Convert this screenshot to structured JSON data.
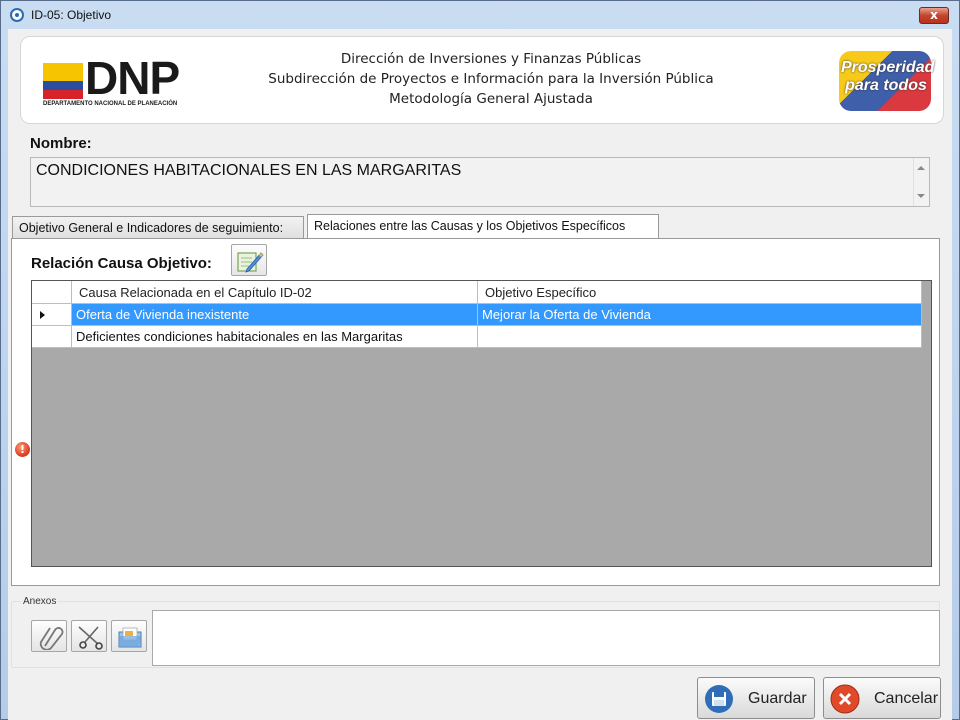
{
  "window": {
    "title": "ID-05: Objetivo",
    "close_label": "x"
  },
  "banner": {
    "logo_text": "DNP",
    "logo_subtitle": "DEPARTAMENTO NACIONAL DE PLANEACIÓN",
    "lines": [
      "Dirección de Inversiones y Finanzas Públicas",
      "Subdirección de Proyectos e Información para la Inversión Pública",
      "Metodología General Ajustada"
    ],
    "slogan_line1": "Prosperidad",
    "slogan_line2": "para todos"
  },
  "nombre": {
    "label": "Nombre:",
    "value": "CONDICIONES HABITACIONALES EN LAS MARGARITAS"
  },
  "tabs": [
    {
      "label": "Objetivo General e Indicadores de seguimiento:"
    },
    {
      "label": "Relaciones entre las Causas y los Objetivos Específicos"
    }
  ],
  "relacion": {
    "label": "Relación Causa Objetivo:"
  },
  "grid": {
    "columns": [
      "Causa Relacionada en el Capítulo ID-02",
      "Objetivo Específico"
    ],
    "rows": [
      {
        "causa": "Oferta de Vivienda inexistente",
        "objetivo": "Mejorar la Oferta de Vivienda",
        "selected": true
      },
      {
        "causa": "Deficientes condiciones habitacionales en las Margaritas",
        "objetivo": "",
        "selected": false
      }
    ]
  },
  "error_icon": "!",
  "anexos": {
    "label": "Anexos",
    "tools": [
      "paperclip-icon",
      "scissors-icon",
      "folder-icon"
    ]
  },
  "buttons": {
    "guardar": "Guardar",
    "cancelar": "Cancelar"
  },
  "colors": {
    "selection": "#3399ff",
    "grid_background": "#a9a9a9",
    "flag_yellow": "#f6c400",
    "flag_blue": "#2a4da0",
    "flag_red": "#d6232a"
  }
}
